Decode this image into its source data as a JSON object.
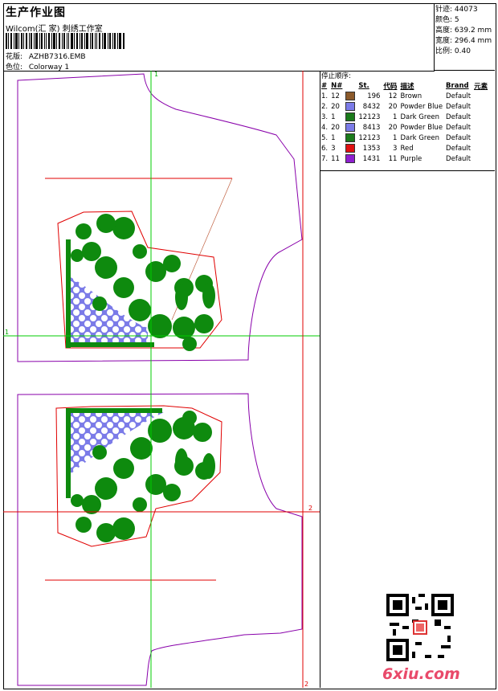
{
  "header": {
    "title": "生产作业图",
    "studio": "Wilcom(汇 家) 刺绣工作室",
    "design_label": "花版:",
    "design_value": "AZHB7316.EMB",
    "colorway_label": "色位:",
    "colorway_value": "Colorway 1"
  },
  "stats": {
    "stitches_label": "针迹:",
    "stitches_value": "44073",
    "colors_label": "颜色:",
    "colors_value": "5",
    "height_label": "高度:",
    "height_value": "639.2 mm",
    "width_label": "宽度:",
    "width_value": "296.4 mm",
    "scale_label": "比例:",
    "scale_value": "0.40"
  },
  "stop_sequence": {
    "title": "停止顺序:",
    "columns": [
      "#",
      "N#",
      "St.",
      "代码",
      "描述",
      "Brand",
      "元素"
    ],
    "rows": [
      {
        "idx": "1.",
        "n": "12",
        "color": "#8B5A2B",
        "st": "196",
        "code": "12",
        "desc": "Brown",
        "brand": "Default"
      },
      {
        "idx": "2.",
        "n": "20",
        "color": "#7B7BE8",
        "st": "8432",
        "code": "20",
        "desc": "Powder Blue",
        "brand": "Default"
      },
      {
        "idx": "3.",
        "n": "1",
        "color": "#1A7A1A",
        "st": "12123",
        "code": "1",
        "desc": "Dark Green",
        "brand": "Default"
      },
      {
        "idx": "4.",
        "n": "20",
        "color": "#7B7BE8",
        "st": "8413",
        "code": "20",
        "desc": "Powder Blue",
        "brand": "Default"
      },
      {
        "idx": "5.",
        "n": "1",
        "color": "#1A7A1A",
        "st": "12123",
        "code": "1",
        "desc": "Dark Green",
        "brand": "Default"
      },
      {
        "idx": "6.",
        "n": "3",
        "color": "#E01010",
        "st": "1353",
        "code": "3",
        "desc": "Red",
        "brand": "Default"
      },
      {
        "idx": "7.",
        "n": "11",
        "color": "#8E1FD0",
        "st": "1431",
        "code": "11",
        "desc": "Purple",
        "brand": "Default"
      }
    ]
  },
  "guides": {
    "v1": "1",
    "h1": "1",
    "v2": "2",
    "h2": "2"
  },
  "watermark": "6xiu.com",
  "colors": {
    "green_guide": "#00CC00",
    "red_guide": "#E00000",
    "piece_outline": "#8800AA",
    "fill_green": "#0E8A0E",
    "fill_blue": "#7B7BE8"
  }
}
